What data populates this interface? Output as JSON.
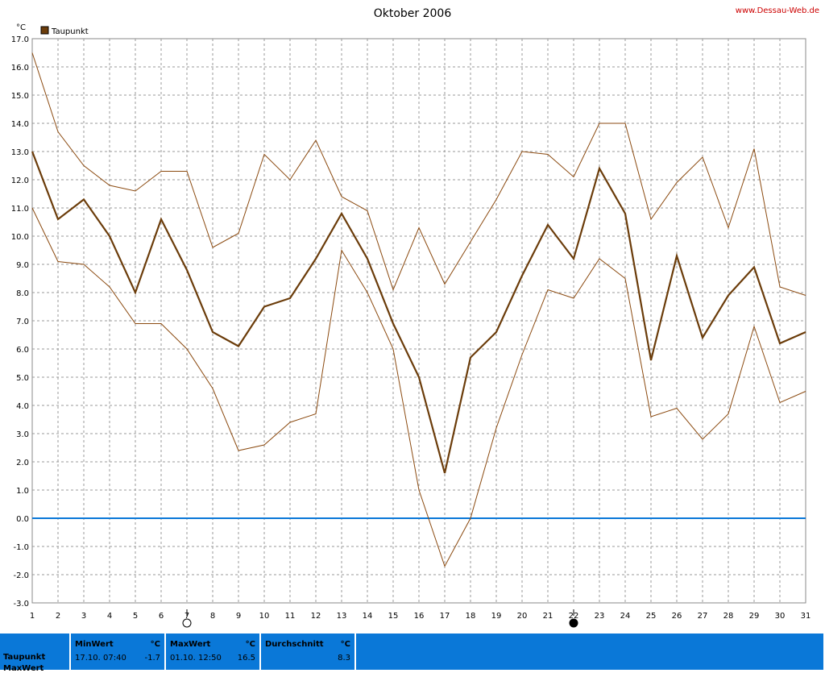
{
  "chart_data": {
    "type": "line",
    "title": "Oktober 2006",
    "watermark": "www.Dessau-Web.de",
    "ylabel": "°C",
    "ylim": [
      -3.0,
      17.0
    ],
    "y_ticks": [
      "17.0",
      "16.0",
      "15.0",
      "14.0",
      "13.0",
      "12.0",
      "11.0",
      "10.0",
      "9.0",
      "8.0",
      "7.0",
      "6.0",
      "5.0",
      "4.0",
      "3.0",
      "2.0",
      "1.0",
      "0.0",
      "-1.0",
      "-2.0",
      "-3.0"
    ],
    "x_ticks": [
      "1",
      "2",
      "3",
      "4",
      "5",
      "6",
      "7",
      "8",
      "9",
      "10",
      "11",
      "12",
      "13",
      "14",
      "15",
      "16",
      "17",
      "18",
      "19",
      "20",
      "21",
      "22",
      "23",
      "24",
      "25",
      "26",
      "27",
      "28",
      "29",
      "30",
      "31"
    ],
    "legend": {
      "position": "top-left",
      "label": "Taupunkt",
      "color": "#6b3c0a"
    },
    "zero_line_color": "#0a78d8",
    "grid": true,
    "moon_phases": [
      {
        "day": 7,
        "phase": "full-moon"
      },
      {
        "day": 22,
        "phase": "new-moon"
      }
    ],
    "series": [
      {
        "name": "Taupunkt",
        "role": "average",
        "color": "#6b3c0a",
        "values": [
          13.0,
          10.6,
          11.3,
          10.0,
          8.0,
          10.6,
          8.8,
          6.6,
          6.1,
          7.5,
          7.8,
          9.2,
          10.8,
          9.2,
          6.9,
          5.0,
          1.6,
          5.7,
          6.6,
          8.6,
          10.4,
          9.2,
          12.4,
          10.8,
          5.6,
          9.3,
          6.4,
          7.9,
          8.9,
          6.2,
          6.6
        ]
      },
      {
        "role": "max",
        "color": "#8b4a10",
        "values": [
          16.5,
          13.7,
          12.5,
          11.8,
          11.6,
          12.3,
          12.3,
          9.6,
          10.1,
          12.9,
          12.0,
          13.4,
          11.4,
          10.9,
          8.1,
          10.3,
          8.3,
          9.8,
          11.3,
          13.0,
          12.9,
          12.1,
          14.0,
          14.0,
          10.6,
          11.9,
          12.8,
          10.3,
          13.1,
          8.2,
          7.9
        ]
      },
      {
        "role": "min",
        "color": "#8b4a10",
        "values": [
          11.0,
          9.1,
          9.0,
          8.2,
          6.9,
          6.9,
          6.0,
          4.6,
          2.4,
          2.6,
          3.4,
          3.7,
          9.5,
          8.0,
          6.0,
          1.0,
          -1.7,
          0.0,
          3.2,
          5.8,
          8.1,
          7.8,
          9.2,
          8.5,
          3.6,
          3.9,
          2.8,
          3.7,
          6.8,
          4.1,
          4.5
        ]
      }
    ]
  },
  "summary": {
    "row_label": "Taupunkt",
    "row_label_2": "MaxWert",
    "min": {
      "header": "MinWert",
      "unit": "°C",
      "when": "17.10.  07:40",
      "value": "-1.7"
    },
    "max": {
      "header": "MaxWert",
      "unit": "°C",
      "when": "01.10.  12:50",
      "value": "16.5"
    },
    "avg": {
      "header": "Durchschnitt",
      "unit": "°C",
      "value": "8.3"
    }
  }
}
